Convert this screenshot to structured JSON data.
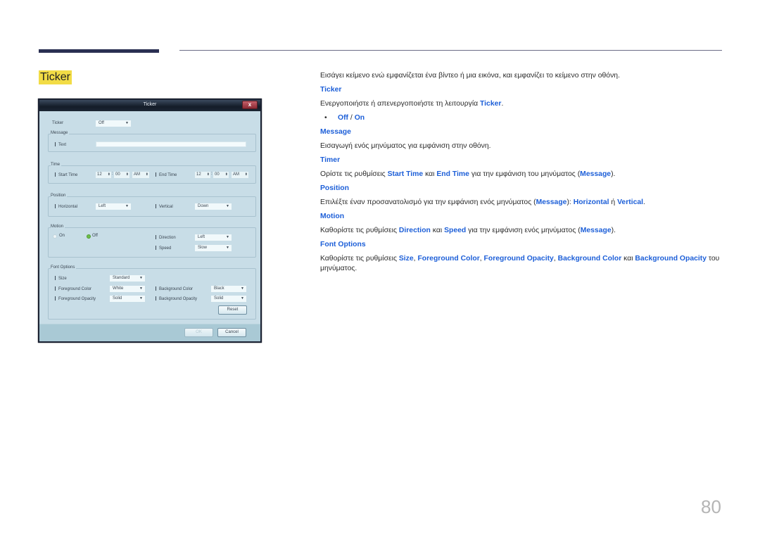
{
  "header": {
    "section_title": "Ticker"
  },
  "page_number": "80",
  "dialog": {
    "title": "Ticker",
    "close_label": "x",
    "ticker": {
      "label": "Ticker",
      "value": "Off"
    },
    "message": {
      "group": "Message",
      "text_label": "Text",
      "text_value": ""
    },
    "time": {
      "group": "Time",
      "start_label": "Start Time",
      "start_hour": "12",
      "start_min": "00",
      "start_ampm": "AM",
      "end_label": "End Time",
      "end_hour": "12",
      "end_min": "00",
      "end_ampm": "AM"
    },
    "position": {
      "group": "Position",
      "horizontal_label": "Horizontal",
      "horizontal_value": "Left",
      "vertical_label": "Vertical",
      "vertical_value": "Down"
    },
    "motion": {
      "group": "Motion",
      "on_label": "On",
      "off_label": "Off",
      "selected": "Off",
      "direction_label": "Direction",
      "direction_value": "Left",
      "speed_label": "Speed",
      "speed_value": "Slow"
    },
    "font": {
      "group": "Font Options",
      "size_label": "Size",
      "size_value": "Standard",
      "fg_color_label": "Foreground Color",
      "fg_color_value": "White",
      "bg_color_label": "Background Color",
      "bg_color_value": "Black",
      "fg_opacity_label": "Foreground Opacity",
      "fg_opacity_value": "Solid",
      "bg_opacity_label": "Background Opacity",
      "bg_opacity_value": "Solid",
      "reset_label": "Reset"
    },
    "ok_label": "OK",
    "cancel_label": "Cancel"
  },
  "description": {
    "intro": "Εισάγει κείμενο ενώ εμφανίζεται ένα βίντεο ή μια εικόνα, και εμφανίζει το κείμενο στην οθόνη.",
    "ticker": {
      "heading": "Ticker",
      "text_a": "Ενεργοποιήστε ή απενεργοποιήστε τη λειτουργία ",
      "text_b": "Ticker",
      "text_c": ".",
      "bullet": "•",
      "opt_off": "Off",
      "opt_sep": " / ",
      "opt_on": "On"
    },
    "message": {
      "heading": "Message",
      "text": "Εισαγωγή ενός μηνύματος για εμφάνιση στην οθόνη."
    },
    "timer": {
      "heading": "Timer",
      "t1": "Ορίστε τις ρυθμίσεις ",
      "k1": "Start Time",
      "t2": " και ",
      "k2": "End Time",
      "t3": " για την εμφάνιση του μηνύματος (",
      "k3": "Message",
      "t4": ")."
    },
    "position": {
      "heading": "Position",
      "t1": "Επιλέξτε έναν προσανατολισμό για την εμφάνιση ενός μηνύματος (",
      "k1": "Message",
      "t2": "): ",
      "k2": "Horizontal",
      "t3": " ή ",
      "k3": "Vertical",
      "t4": "."
    },
    "motion": {
      "heading": "Motion",
      "t1": "Καθορίστε τις ρυθμίσεις ",
      "k1": "Direction",
      "t2": " και ",
      "k2": "Speed",
      "t3": " για την εμφάνιση ενός μηνύματος (",
      "k3": "Message",
      "t4": ")."
    },
    "font_options": {
      "heading": "Font Options",
      "t1": "Καθορίστε τις ρυθμίσεις ",
      "k1": "Size",
      "t2": ", ",
      "k2": "Foreground Color",
      "t3": ", ",
      "k3": "Foreground Opacity",
      "t4": ", ",
      "k4": "Background Color",
      "t5": " και ",
      "k5": "Background Opacity",
      "t6": " του μηνύματος."
    }
  },
  "colors": {
    "accent_blue": "#1d5fd8",
    "highlight_yellow": "#f2dc46",
    "header_bar": "#2a2f52"
  }
}
